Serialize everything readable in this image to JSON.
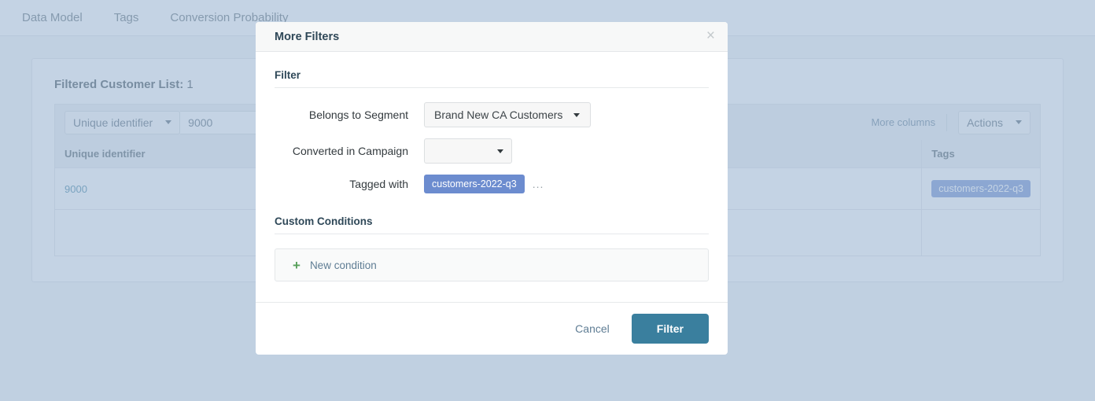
{
  "background": {
    "nav": {
      "items": [
        {
          "label": "Data Model"
        },
        {
          "label": "Tags"
        },
        {
          "label": "Conversion Probability"
        }
      ]
    },
    "panel": {
      "title": "Filtered Customer List:",
      "count": "1",
      "filterbar": {
        "field_select": "Unique identifier",
        "search_value": "9000",
        "more_columns_label": "More columns",
        "actions_label": "Actions"
      },
      "table": {
        "columns": [
          "Unique identifier",
          "Tags"
        ],
        "rows": [
          {
            "unique_identifier": "9000",
            "tag": "customers-2022-q3"
          }
        ]
      }
    }
  },
  "modal": {
    "title": "More Filters",
    "close_label": "×",
    "sections": {
      "filter": {
        "heading": "Filter",
        "rows": [
          {
            "label": "Belongs to Segment",
            "value": "Brand New CA Customers"
          },
          {
            "label": "Converted in Campaign",
            "value": ""
          }
        ],
        "tagged_with": {
          "label": "Tagged with",
          "tag": "customers-2022-q3",
          "more": "..."
        }
      },
      "custom_conditions": {
        "heading": "Custom Conditions",
        "new_condition_label": "New condition",
        "plus_glyph": "+"
      }
    },
    "footer": {
      "cancel_label": "Cancel",
      "submit_label": "Filter"
    }
  },
  "colors": {
    "primary_button": "#3a7f9e",
    "tag_pill": "#6c8ccf",
    "heading": "#2f4858",
    "plus_green": "#57a05a",
    "overlay": "#9fb8d4"
  }
}
